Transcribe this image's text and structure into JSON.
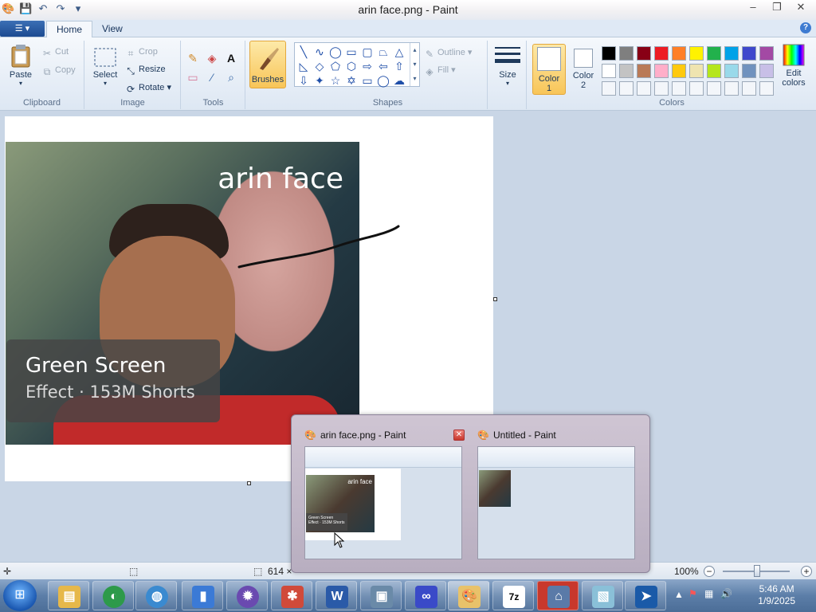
{
  "window": {
    "title": "arin face.png - Paint",
    "qat_icons": [
      "paint-app-icon",
      "save-icon",
      "undo-icon",
      "redo-icon",
      "customize-qat-icon"
    ]
  },
  "ribbon": {
    "tabs": [
      "Home",
      "View"
    ],
    "active_tab": "Home",
    "clipboard": {
      "paste": "Paste",
      "cut": "Cut",
      "copy": "Copy",
      "group": "Clipboard"
    },
    "image": {
      "select": "Select",
      "crop": "Crop",
      "resize": "Resize",
      "rotate": "Rotate",
      "group": "Image"
    },
    "tools": {
      "group": "Tools"
    },
    "brushes": "Brushes",
    "shapes": {
      "outline": "Outline",
      "fill": "Fill",
      "group": "Shapes"
    },
    "size": "Size",
    "color1": "Color\n1",
    "color1_line1": "Color",
    "color1_line2": "1",
    "color2_line1": "Color",
    "color2_line2": "2",
    "edit_colors_line1": "Edit",
    "edit_colors_line2": "colors",
    "colors_group": "Colors",
    "palette_row1": [
      "#000000",
      "#7f7f7f",
      "#880015",
      "#ed1c24",
      "#ff7f27",
      "#fff200",
      "#22b14c",
      "#00a2e8",
      "#3f48cc",
      "#a349a4"
    ],
    "palette_row2": [
      "#ffffff",
      "#c3c3c3",
      "#b97a57",
      "#ffaec9",
      "#ffc90e",
      "#efe4b0",
      "#b5e61d",
      "#99d9ea",
      "#7092be",
      "#c8bfe7"
    ]
  },
  "canvas": {
    "overlay_text": "arin face",
    "badge_title": "Green Screen",
    "badge_subtitle": "Effect · 153M Shorts"
  },
  "preview": {
    "items": [
      {
        "title": "arin face.png - Paint",
        "mini_caption": "arin face",
        "mini_badge_1": "Green Screen",
        "mini_badge_2": "Effect · 153M Shorts"
      },
      {
        "title": "Untitled - Paint"
      }
    ]
  },
  "status": {
    "size_text": "614 ×",
    "zoom": "100%"
  },
  "taskbar": {
    "time": "5:46 AM",
    "date": "1/9/2025",
    "apps": [
      "explorer",
      "camtasia",
      "browser",
      "ie",
      "usb-tool",
      "game",
      "paint-spider",
      "word",
      "computer-mgmt",
      "infinity-app",
      "paint",
      "7zip",
      "network-tool",
      "notes",
      "file-transfer"
    ],
    "letters": {
      "word": "W",
      "zip": "7z"
    }
  }
}
